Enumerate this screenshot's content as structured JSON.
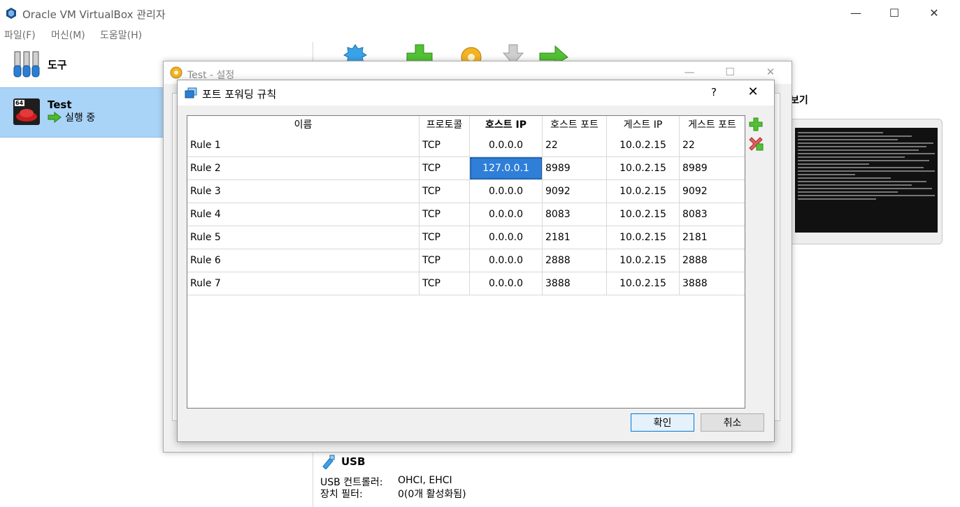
{
  "main_window": {
    "title": "Oracle VM VirtualBox 관리자",
    "menu": [
      "파일(F)",
      "머신(M)",
      "도움말(H)"
    ],
    "tools_label": "도구",
    "vm": {
      "name": "Test",
      "state": "실행 중",
      "os_badge": "64"
    },
    "preview_label": "보기",
    "usb": {
      "title": "USB",
      "controller_label": "USB 컨트롤러:",
      "controller_value": "OHCI, EHCI",
      "filter_label": "장치 필터:",
      "filter_value": "0(0개 활성화됨)"
    }
  },
  "settings_dialog": {
    "title": "Test - 설정"
  },
  "port_forwarding_dialog": {
    "title": "포트 포워딩 규칙",
    "help": "?",
    "columns": [
      "이름",
      "프로토콜",
      "호스트 IP",
      "호스트 포트",
      "게스트 IP",
      "게스트 포트"
    ],
    "sorted_column": 2,
    "rules": [
      {
        "name": "Rule 1",
        "protocol": "TCP",
        "host_ip": "0.0.0.0",
        "host_port": "22",
        "guest_ip": "10.0.2.15",
        "guest_port": "22"
      },
      {
        "name": "Rule 2",
        "protocol": "TCP",
        "host_ip": "127.0.0.1",
        "host_port": "8989",
        "guest_ip": "10.0.2.15",
        "guest_port": "8989"
      },
      {
        "name": "Rule 3",
        "protocol": "TCP",
        "host_ip": "0.0.0.0",
        "host_port": "9092",
        "guest_ip": "10.0.2.15",
        "guest_port": "9092"
      },
      {
        "name": "Rule 4",
        "protocol": "TCP",
        "host_ip": "0.0.0.0",
        "host_port": "8083",
        "guest_ip": "10.0.2.15",
        "guest_port": "8083"
      },
      {
        "name": "Rule 5",
        "protocol": "TCP",
        "host_ip": "0.0.0.0",
        "host_port": "2181",
        "guest_ip": "10.0.2.15",
        "guest_port": "2181"
      },
      {
        "name": "Rule 6",
        "protocol": "TCP",
        "host_ip": "0.0.0.0",
        "host_port": "2888",
        "guest_ip": "10.0.2.15",
        "guest_port": "2888"
      },
      {
        "name": "Rule 7",
        "protocol": "TCP",
        "host_ip": "0.0.0.0",
        "host_port": "3888",
        "guest_ip": "10.0.2.15",
        "guest_port": "3888"
      }
    ],
    "selected_row": 1,
    "ok_label": "확인",
    "cancel_label": "취소"
  },
  "colors": {
    "selection": "#2f7fd8",
    "vm_row_highlight": "#a9d3f7",
    "ok_border": "#0078d7"
  }
}
